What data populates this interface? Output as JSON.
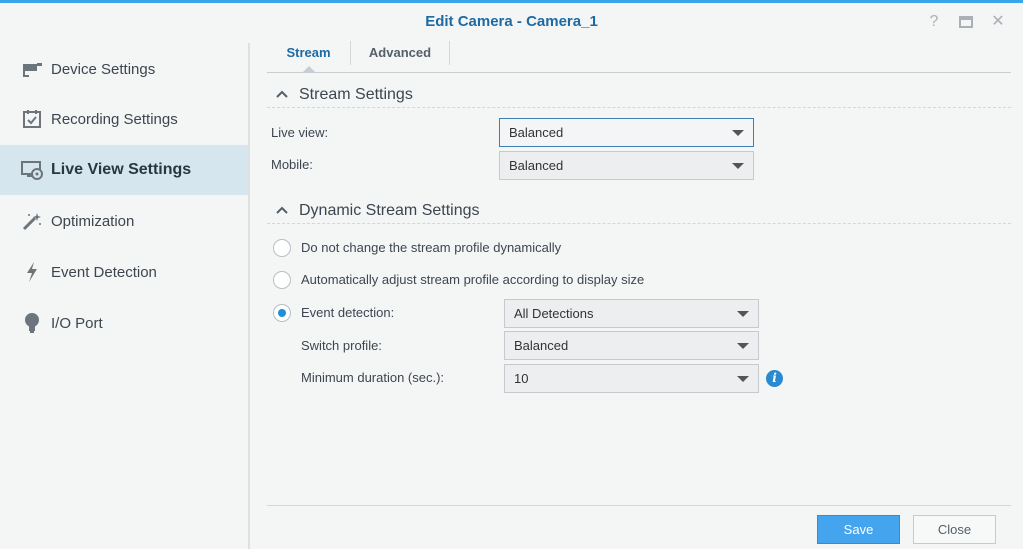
{
  "window": {
    "title": "Edit Camera - Camera_1",
    "controls": {
      "help": "?",
      "maximize": "□",
      "close": "✕"
    }
  },
  "sidebar": {
    "items": [
      {
        "label": "Device Settings",
        "icon": "camera-icon",
        "active": false
      },
      {
        "label": "Recording Settings",
        "icon": "calendar-check-icon",
        "active": false
      },
      {
        "label": "Live View Settings",
        "icon": "monitor-camera-icon",
        "active": true
      },
      {
        "label": "Optimization",
        "icon": "magic-wand-icon",
        "active": false
      },
      {
        "label": "Event Detection",
        "icon": "lightning-icon",
        "active": false
      },
      {
        "label": "I/O Port",
        "icon": "bulb-icon",
        "active": false
      }
    ]
  },
  "tabs": [
    {
      "label": "Stream",
      "active": true
    },
    {
      "label": "Advanced",
      "active": false
    }
  ],
  "stream_settings": {
    "title": "Stream Settings",
    "live_view_label": "Live view:",
    "live_view_value": "Balanced",
    "mobile_label": "Mobile:",
    "mobile_value": "Balanced"
  },
  "dynamic_stream_settings": {
    "title": "Dynamic Stream Settings",
    "options": [
      {
        "label": "Do not change the stream profile dynamically",
        "checked": false
      },
      {
        "label": "Automatically adjust stream profile according to display size",
        "checked": false
      },
      {
        "label": "Event detection:",
        "checked": true
      }
    ],
    "event_detection_value": "All Detections",
    "switch_profile_label": "Switch profile:",
    "switch_profile_value": "Balanced",
    "min_duration_label": "Minimum duration (sec.):",
    "min_duration_value": "10"
  },
  "footer": {
    "save_label": "Save",
    "close_label": "Close"
  },
  "colors": {
    "accent": "#3aa6ea",
    "title_text": "#1e6aa3",
    "active_sidebar_bg": "#d6e6ef",
    "primary_button": "#44a5ee"
  }
}
